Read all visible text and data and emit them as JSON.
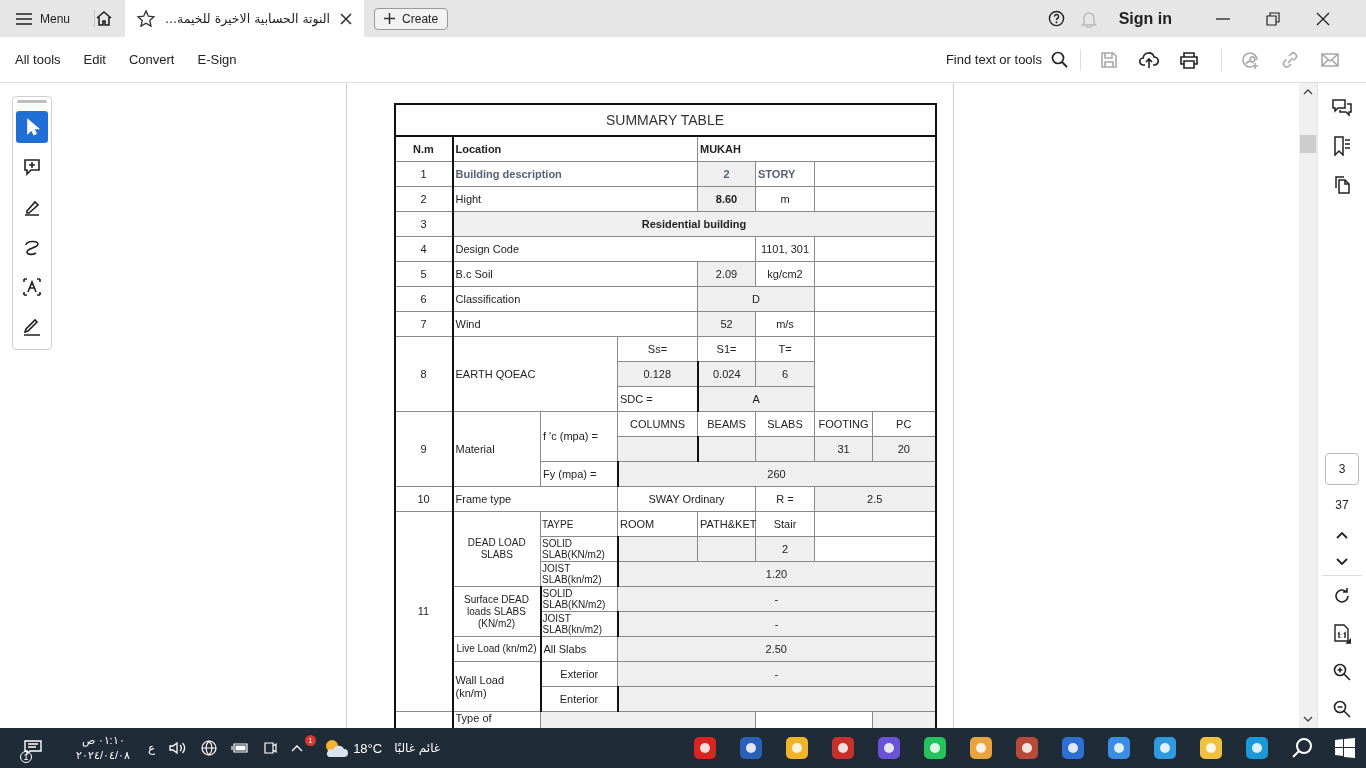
{
  "app_bar": {
    "menu": "Menu",
    "tabs": [
      {
        "title": "النوتة الحسابية الاخيرة للخيمة...",
        "selected": true
      }
    ],
    "create": "Create",
    "sign_in": "Sign in"
  },
  "toolbar": {
    "menus": [
      "All tools",
      "Edit",
      "Convert",
      "E-Sign"
    ],
    "find": "Find text or tools",
    "actions": [
      {
        "kind": "save",
        "disabled": true
      },
      {
        "kind": "upload",
        "disabled": false
      },
      {
        "kind": "print",
        "disabled": false
      },
      {
        "kind": "share",
        "disabled": true
      },
      {
        "kind": "link",
        "disabled": true
      },
      {
        "kind": "mail",
        "disabled": true
      }
    ]
  },
  "tools": [
    {
      "kind": "select",
      "selected": true
    },
    {
      "kind": "comment",
      "selected": false
    },
    {
      "kind": "highlight",
      "selected": false
    },
    {
      "kind": "draw",
      "selected": false
    },
    {
      "kind": "text",
      "selected": false
    },
    {
      "kind": "sign",
      "selected": false
    }
  ],
  "table": {
    "rows": [
      {
        "cells": [
          {
            "text": "SUMMARY TABLE",
            "kind": "title",
            "colspan": 8
          }
        ]
      },
      {
        "cells": [
          {
            "text": "N.m",
            "kind": "heading"
          },
          {
            "text": "Location",
            "kind": "heading-left",
            "colspan": 3
          },
          {
            "text": "MUKAH",
            "kind": "heading-left",
            "colspan": 4
          }
        ]
      },
      {
        "cells": [
          {
            "text": "1",
            "kind": "center"
          },
          {
            "text": "Building description",
            "kind": "accent",
            "colspan": 3
          },
          {
            "text": "2",
            "kind": "accent-value"
          },
          {
            "text": "STORY",
            "kind": "accent"
          },
          {
            "kind": "blank",
            "colspan": 2
          }
        ]
      },
      {
        "cells": [
          {
            "text": "2",
            "kind": "center"
          },
          {
            "text": "Hight",
            "kind": "label",
            "colspan": 3
          },
          {
            "text": "8.60",
            "kind": "heading-value"
          },
          {
            "text": "m",
            "kind": "center"
          },
          {
            "kind": "blank",
            "colspan": 2
          }
        ]
      },
      {
        "cells": [
          {
            "text": "3",
            "kind": "center"
          },
          {
            "text": "Residential building",
            "kind": "heading-value",
            "colspan": 7
          }
        ]
      },
      {
        "cells": [
          {
            "text": "4",
            "kind": "center"
          },
          {
            "text": "Design Code",
            "kind": "label",
            "colspan": 4
          },
          {
            "text": "1101, 301",
            "kind": "center"
          },
          {
            "kind": "blank",
            "colspan": 2
          }
        ]
      },
      {
        "cells": [
          {
            "text": "5",
            "kind": "center"
          },
          {
            "text": "B.c Soil",
            "kind": "label",
            "colspan": 3
          },
          {
            "text": "2.09",
            "kind": "value"
          },
          {
            "text": "kg/cm2",
            "kind": "center"
          },
          {
            "kind": "blank",
            "colspan": 2
          }
        ]
      },
      {
        "cells": [
          {
            "text": "6",
            "kind": "center"
          },
          {
            "text": "Classification",
            "kind": "label",
            "colspan": 3
          },
          {
            "text": "D",
            "kind": "value",
            "colspan": 2
          },
          {
            "kind": "blank",
            "colspan": 2
          }
        ]
      },
      {
        "cells": [
          {
            "text": "7",
            "kind": "center"
          },
          {
            "text": "Wind",
            "kind": "label",
            "colspan": 3
          },
          {
            "text": "52",
            "kind": "value"
          },
          {
            "text": "m/s",
            "kind": "center"
          },
          {
            "kind": "blank",
            "colspan": 2
          }
        ]
      },
      {
        "cells": [
          {
            "text": "8",
            "kind": "center",
            "rowspan": 3
          },
          {
            "text": "EARTH QOEAC",
            "kind": "label",
            "colspan": 2,
            "rowspan": 3
          },
          {
            "text": "Ss=",
            "kind": "center"
          },
          {
            "text": "S1=",
            "kind": "center"
          },
          {
            "text": "T=",
            "kind": "center"
          },
          {
            "kind": "blank",
            "colspan": 2,
            "rowspan": 3
          }
        ]
      },
      {
        "cells": [
          {
            "text": "0.128",
            "kind": "value"
          },
          {
            "text": "0.024",
            "kind": "value"
          },
          {
            "text": "6",
            "kind": "value"
          }
        ]
      },
      {
        "cells": [
          {
            "text": "SDC =",
            "kind": "label"
          },
          {
            "text": "A",
            "kind": "value",
            "colspan": 2
          }
        ]
      },
      {
        "cells": [
          {
            "text": "9",
            "kind": "center",
            "rowspan": 3
          },
          {
            "text": "Material",
            "kind": "label",
            "rowspan": 3
          },
          {
            "text": "f 'c (mpa) =",
            "kind": "label",
            "rowspan": 2
          },
          {
            "text": "COLUMNS",
            "kind": "center"
          },
          {
            "text": "BEAMS",
            "kind": "center"
          },
          {
            "text": "SLABS",
            "kind": "center"
          },
          {
            "text": "FOOTING",
            "kind": "center"
          },
          {
            "text": "PC",
            "kind": "center"
          }
        ]
      },
      {
        "cells": [
          {
            "kind": "blank-value"
          },
          {
            "kind": "blank-value"
          },
          {
            "kind": "blank-value"
          },
          {
            "text": "31",
            "kind": "value"
          },
          {
            "text": "20",
            "kind": "value"
          }
        ]
      },
      {
        "cells": [
          {
            "text": "Fy (mpa) =",
            "kind": "label"
          },
          {
            "text": "260",
            "kind": "value",
            "colspan": 5
          }
        ]
      },
      {
        "cells": [
          {
            "text": "10",
            "kind": "center"
          },
          {
            "text": "Frame type",
            "kind": "label",
            "colspan": 2
          },
          {
            "text": "SWAY Ordinary",
            "kind": "center",
            "colspan": 2
          },
          {
            "text": "R =",
            "kind": "center"
          },
          {
            "text": "2.5",
            "kind": "value",
            "colspan": 2
          }
        ]
      },
      {
        "cells": [
          {
            "text": "11",
            "kind": "center",
            "rowspan": 8
          },
          {
            "text": "DEAD LOAD SLABS",
            "kind": "note",
            "rowspan": 3
          },
          {
            "text": "TAYPE",
            "kind": "small"
          },
          {
            "text": "ROOM",
            "kind": "label"
          },
          {
            "text": "PATH&KET",
            "kind": "label"
          },
          {
            "text": "Stair",
            "kind": "center"
          },
          {
            "kind": "blank",
            "colspan": 2
          }
        ]
      },
      {
        "cells": [
          {
            "text": "SOLID SLAB(KN/m2)",
            "kind": "small"
          },
          {
            "kind": "blank-value"
          },
          {
            "kind": "blank-value"
          },
          {
            "text": "2",
            "kind": "value"
          },
          {
            "kind": "blank",
            "colspan": 2
          }
        ]
      },
      {
        "cells": [
          {
            "text": "JOIST SLAB(kn/m2)",
            "kind": "small"
          },
          {
            "text": "1.20",
            "kind": "value",
            "colspan": 5
          }
        ]
      },
      {
        "cells": [
          {
            "text": "Surface DEAD loads SLABS (KN/m2)",
            "kind": "note",
            "rowspan": 2
          },
          {
            "text": "SOLID SLAB(KN/m2)",
            "kind": "small"
          },
          {
            "text": "-",
            "kind": "value",
            "colspan": 5
          }
        ]
      },
      {
        "cells": [
          {
            "text": "JOIST SLAB(kn/m2)",
            "kind": "small"
          },
          {
            "text": "-",
            "kind": "value",
            "colspan": 5
          }
        ]
      },
      {
        "cells": [
          {
            "text": "Live Load (kn/m2)",
            "kind": "note"
          },
          {
            "text": "All Slabs",
            "kind": "label"
          },
          {
            "text": "2.50",
            "kind": "value",
            "colspan": 5
          }
        ]
      },
      {
        "cells": [
          {
            "text": "Wall Load (kn/m)",
            "kind": "label",
            "rowspan": 2
          },
          {
            "text": "Exterior",
            "kind": "center"
          },
          {
            "text": "-",
            "kind": "value",
            "colspan": 5
          }
        ]
      },
      {
        "cells": [
          {
            "text": "Enterior",
            "kind": "center"
          },
          {
            "kind": "blank-value",
            "colspan": 5
          }
        ]
      },
      {
        "cells": [
          {
            "kind": "blank"
          },
          {
            "text": "Type of",
            "kind": "top-label"
          },
          {
            "kind": "blank-value",
            "colspan": 3
          },
          {
            "kind": "blank",
            "colspan": 2
          },
          {
            "kind": "blank-value"
          }
        ]
      }
    ]
  },
  "navigation": {
    "page": "3",
    "page_count": "37"
  },
  "taskbar": {
    "notifications": "1",
    "time": "٠١:١٠ ص",
    "date": "٢٠٢٤/٠٤/٠٨",
    "language": "ع",
    "weather_badge": "1",
    "temperature": "18°C",
    "weather": "غائم غالبًا"
  }
}
